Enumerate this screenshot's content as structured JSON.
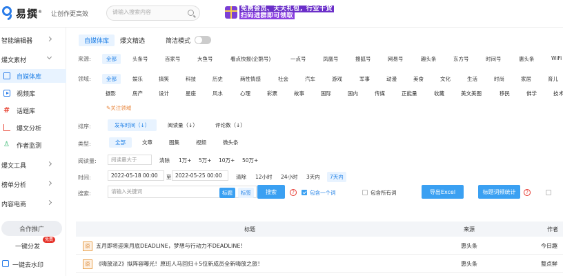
{
  "header": {
    "logo_text": "易撰",
    "logo_sup": "®",
    "slogan": "让创作更高效",
    "search_placeholder": "请输入搜索内容",
    "promo_line1": "免费会员、天天礼包，行业干货",
    "promo_line2": "扫码进群即可领取"
  },
  "sidebar": {
    "items": [
      {
        "label": "智能编辑器"
      },
      {
        "label": "爆文素材"
      },
      {
        "label": "自媒体库"
      },
      {
        "label": "视频库"
      },
      {
        "label": "话题库"
      },
      {
        "label": "爆文分析"
      },
      {
        "label": "作者监测"
      },
      {
        "label": "爆文工具"
      },
      {
        "label": "榜单分析"
      },
      {
        "label": "内容电商"
      }
    ],
    "coop": "合作推广",
    "one_click_publish": "一键分发",
    "free_badge": "免费",
    "remove_watermark": "一键去水印"
  },
  "tabs": {
    "t1": "自媒体库",
    "t2": "爆文精选",
    "mode": "简洁模式"
  },
  "filters": {
    "source_label": "来源:",
    "sources": [
      "全部",
      "头条号",
      "百家号",
      "大鱼号",
      "看点快报(企鹅号)",
      "一点号",
      "凤凰号",
      "搜狐号",
      "网易号",
      "趣头条",
      "东方号",
      "时间号",
      "惠头条",
      "WiFi"
    ],
    "field_label": "领域:",
    "fields1": [
      "全部",
      "娱乐",
      "搞笑",
      "科技",
      "历史",
      "两性情感",
      "社会",
      "汽车",
      "游戏",
      "军事",
      "动漫",
      "美食",
      "文化",
      "生活",
      "时尚",
      "家居",
      "育儿"
    ],
    "fields2": [
      "摄影",
      "房产",
      "设计",
      "星座",
      "风水",
      "心理",
      "彩票",
      "故事",
      "国际",
      "国内",
      "传媒",
      "正能量",
      "收藏",
      "美文美图",
      "移民",
      "佛学",
      "技术"
    ],
    "fav": "关注领域",
    "sort_label": "排序:",
    "sorts": [
      "发布时间（↓）",
      "阅读量（↓）",
      "评论数（↓）"
    ],
    "type_label": "类型:",
    "types": [
      "全部",
      "文章",
      "图集",
      "视频",
      "微头条"
    ],
    "read_label": "阅读量:",
    "read_placeholder": "阅读量大于",
    "read_clear": "清除",
    "read_opts": [
      "1万+",
      "5万+",
      "10万+",
      "50万+"
    ],
    "time_label": "时间:",
    "time_start": "2022-05-18 00:00",
    "time_to": "至",
    "time_end": "2022-05-25 00:00",
    "time_clear": "清除",
    "time_opts": [
      "12小时",
      "24小时",
      "3天内",
      "7天内"
    ],
    "search_label": "搜索:",
    "kw_placeholder": "请输入关键词",
    "seg_title": "标题",
    "seg_tag": "标签",
    "search_btn": "搜索",
    "include_one": "包含一个词",
    "include_all": "包含所有词",
    "export_btn": "导出Excel",
    "stat_btn": "标题词频统计"
  },
  "table": {
    "col_title": "标题",
    "col_source": "来源",
    "col_author": "作者",
    "orig_mark": "原",
    "rows": [
      {
        "title": "五月即将迎来月底DEADLINE，梦想与行动力不DEADLINE！",
        "source": "惠头条",
        "author": "今日趣"
      },
      {
        "title": "《嗨放派2》拟阵容曝光！原班人马回归＋5位新成员全新嗨放之旅！",
        "source": "惠头条",
        "author": "整点鲜"
      }
    ]
  }
}
